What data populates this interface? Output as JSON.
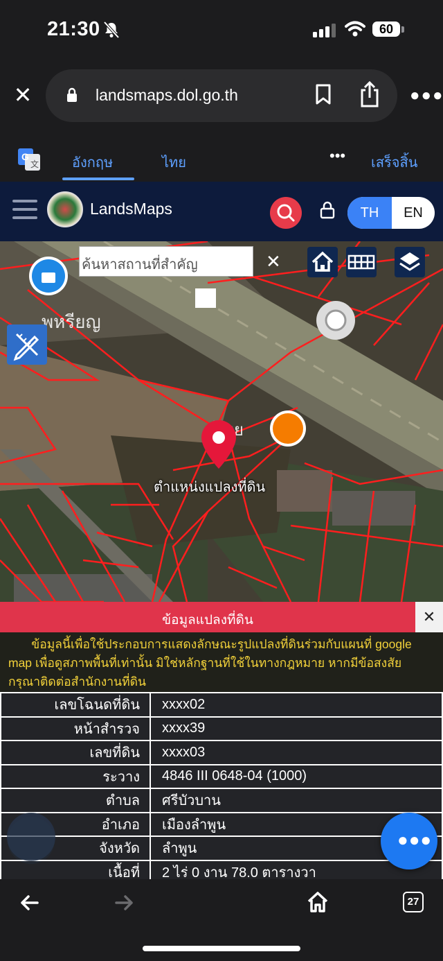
{
  "status": {
    "time": "21:30",
    "battery": "60"
  },
  "browser": {
    "url": "landsmaps.dol.go.th"
  },
  "translate": {
    "tab_english": "อังกฤษ",
    "tab_thai": "ไทย",
    "done": "เสร็จสิ้น",
    "more": "•••"
  },
  "site": {
    "brand": "LandsMaps",
    "lang_th": "TH",
    "lang_en": "EN"
  },
  "map": {
    "search_placeholder": "ค้นหาสถานที่สำคัญ",
    "pin_label": "ตำแหน่งแปลงที่ดิน"
  },
  "panel": {
    "title": "ข้อมูลแปลงที่ดิน",
    "close": "✕",
    "note_line1": "ข้อมูลนี้เพื่อใช้ประกอบการแสดงลักษณะรูปแปลงที่ดินร่วมกับแผนที่ google",
    "note_line2": "map เพื่อดูสภาพพื้นที่เท่านั้น มิใช่หลักฐานที่ใช้ในทางกฎหมาย หากมีข้อสงสัย",
    "note_line3": "กรุณาติดต่อสำนักงานที่ดิน",
    "rows": [
      {
        "label": "เลขโฉนดที่ดิน",
        "value": "xxxx02"
      },
      {
        "label": "หน้าสำรวจ",
        "value": "xxxx39"
      },
      {
        "label": "เลขที่ดิน",
        "value": "xxxx03"
      },
      {
        "label": "ระวาง",
        "value": "4846 III 0648-04 (1000)"
      },
      {
        "label": "ตำบล",
        "value": "ศรีบัวบาน"
      },
      {
        "label": "อำเภอ",
        "value": "เมืองลำพูน"
      },
      {
        "label": "จังหวัด",
        "value": "ลำพูน"
      },
      {
        "label": "เนื้อที่",
        "value": "2 ไร่ 0 งาน 78.0 ตารางวา"
      }
    ]
  },
  "toolbar": {
    "tabs_count": "27"
  },
  "colors": {
    "accent_blue": "#1d79f2",
    "panel_red": "#e0344b",
    "header_navy": "#0d1b3c",
    "note_yellow": "#f3d23a"
  },
  "icons": [
    "bell-slash-icon",
    "signal-icon",
    "wifi-icon",
    "battery-icon",
    "close-icon",
    "lock-icon",
    "bookmark-icon",
    "share-icon",
    "more-icon",
    "google-translate-icon",
    "hamburger-icon",
    "seal-logo",
    "search-icon",
    "lock-icon",
    "home-icon",
    "grid-icon",
    "layers-icon",
    "draw-ruler-icon",
    "map-pin-icon",
    "dots-icon",
    "back-arrow-icon",
    "forward-arrow-icon",
    "home-icon",
    "tabs-icon"
  ]
}
